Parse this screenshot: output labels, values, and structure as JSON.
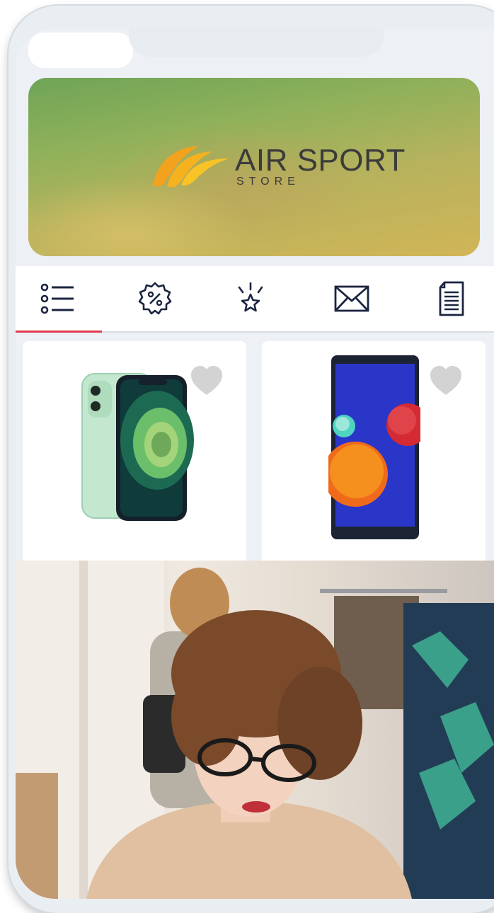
{
  "banner": {
    "brand_title": "AIR SPORT",
    "brand_subtitle": "STORE"
  },
  "tabs": [
    {
      "icon": "list-icon",
      "active": true
    },
    {
      "icon": "discount-badge-icon",
      "active": false
    },
    {
      "icon": "sparkle-star-icon",
      "active": false
    },
    {
      "icon": "envelope-icon",
      "active": false
    },
    {
      "icon": "document-icon",
      "active": false
    }
  ],
  "products": [
    {
      "image": "green-iphone",
      "favorite": false
    },
    {
      "image": "blue-android-phone",
      "favorite": false
    }
  ],
  "colors": {
    "accent": "#e0394f",
    "icon_dark": "#1b2540",
    "heart": "#d3d3d3"
  },
  "promo_photo": "woman-with-glasses-in-clothing-store"
}
